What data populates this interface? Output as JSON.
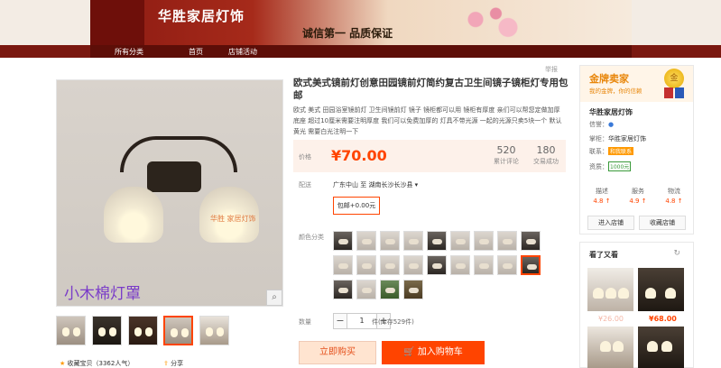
{
  "banner": {
    "title": "华胜家居灯饰",
    "slogan": "诚信第一  品质保证"
  },
  "nav": {
    "items": [
      "所有分类",
      "首页",
      "店铺活动"
    ]
  },
  "report": "举报",
  "product": {
    "title": "欧式美式镜前灯创意田园镜前灯简约复古卫生间镜子镜柜灯专用包邮",
    "subtitle": "欧式 美式 田园浴室镜前灯 卫生间镜前灯 镜子 镜柜都可以用 镜柜有厚度 亲们可以帮您定做加厚底座 超过10厘米需要注明厚度 我们可以免费加厚的 灯具不带光源 一起的光源只卖5块一个 默认黄光 需要白光注明一下",
    "price_label": "价格",
    "price": "¥70.00",
    "reviews_count": "520",
    "reviews_label": "累计评论",
    "sales_count": "180",
    "sales_label": "交易成功",
    "shipping_label": "配送",
    "shipping": "广东中山 至  湖南长沙长沙县 ▾",
    "package": "包邮+0.00元",
    "color_label": "颜色分类",
    "qty_label": "数量",
    "qty": "1",
    "stock": "件(库存529件)",
    "buy_now": "立即购买",
    "add_cart": "加入购物车"
  },
  "gallery": {
    "watermark_small": "华胜 家居灯饰",
    "watermark_big": "小木棉灯罩",
    "favorite": "收藏宝贝（3362人气）",
    "share": "分享"
  },
  "seller": {
    "level": "金牌卖家",
    "level_sub": "我的金牌，你的信赖",
    "medal": "金",
    "shop_name": "华胜家居灯饰",
    "credit_label": "信誉：",
    "keeper_label": "掌柜：",
    "keeper": "华胜家居灯饰",
    "contact_label": "联系：",
    "contact": "和我联系",
    "qual_label": "资质：",
    "qual": "1000元",
    "dsr": [
      {
        "label": "描述",
        "score": "4.8 ↑"
      },
      {
        "label": "服务",
        "score": "4.9 ↑"
      },
      {
        "label": "物流",
        "score": "4.8 ↑"
      }
    ],
    "enter_shop": "进入店铺",
    "fav_shop": "收藏店铺"
  },
  "also_like": {
    "title": "看了又看",
    "refresh": "↻",
    "items": [
      {
        "price": "¥26.00",
        "old": true
      },
      {
        "price": "¥68.00",
        "old": false
      }
    ]
  }
}
